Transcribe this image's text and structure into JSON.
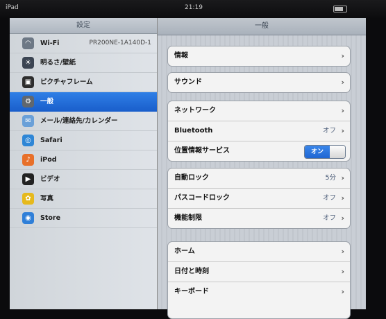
{
  "statusbar": {
    "device": "iPad",
    "time": "21:19"
  },
  "left": {
    "header": "設定",
    "items": [
      {
        "label": "Wi-Fi",
        "value": "PR200NE-1A140D-1",
        "icon": "wifi-icon",
        "color": "#6d7885"
      },
      {
        "label": "明るさ/壁紙",
        "icon": "brightness-icon",
        "color": "#3b4452"
      },
      {
        "label": "ピクチャフレーム",
        "icon": "picture-frame-icon",
        "color": "#2d2d2d"
      },
      {
        "label": "一般",
        "icon": "gear-icon",
        "color": "#60676f"
      },
      {
        "label": "メール/連絡先/カレンダー",
        "icon": "mail-icon",
        "color": "#6aa0d8"
      },
      {
        "label": "Safari",
        "icon": "safari-icon",
        "color": "#2e86d6"
      },
      {
        "label": "iPod",
        "icon": "ipod-icon",
        "color": "#e8702a"
      },
      {
        "label": "ビデオ",
        "icon": "video-icon",
        "color": "#222"
      },
      {
        "label": "写真",
        "icon": "photos-icon",
        "color": "#e6b91c"
      },
      {
        "label": "Store",
        "icon": "store-icon",
        "color": "#2f7fd8"
      }
    ],
    "selected_index": 3
  },
  "right": {
    "header": "一般",
    "groups": [
      {
        "rows": [
          {
            "label": "情報"
          }
        ]
      },
      {
        "rows": [
          {
            "label": "サウンド"
          }
        ]
      },
      {
        "rows": [
          {
            "label": "ネットワーク"
          },
          {
            "label": "Bluetooth",
            "value": "オフ"
          },
          {
            "label": "位置情報サービス",
            "toggle": "オン"
          }
        ]
      },
      {
        "rows": [
          {
            "label": "自動ロック",
            "value": "5分"
          },
          {
            "label": "パスコードロック",
            "value": "オフ"
          },
          {
            "label": "機能制限",
            "value": "オフ"
          }
        ]
      },
      {
        "rows": [
          {
            "label": "ホーム"
          },
          {
            "label": "日付と時刻"
          },
          {
            "label": "キーボード"
          }
        ]
      }
    ]
  },
  "colors": {
    "selection": "#2a74e0",
    "toggle_on": "#2f7ae4"
  }
}
